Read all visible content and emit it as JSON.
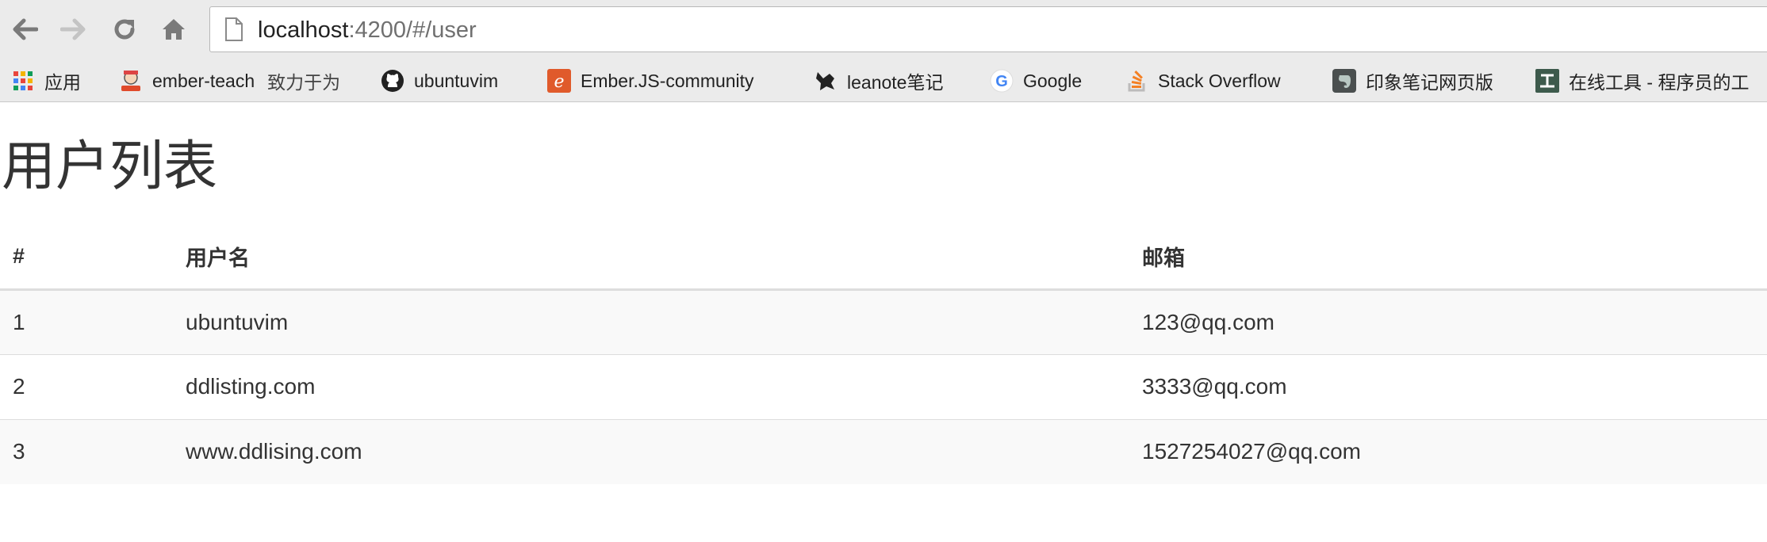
{
  "browser": {
    "url_host": "localhost",
    "url_rest": ":4200/#/user",
    "bookmarks": [
      {
        "label": "应用",
        "icon": "apps-grid-icon"
      },
      {
        "label": "ember-teach",
        "note": "致力于为",
        "icon": "ember-teach-icon"
      },
      {
        "label": "ubuntuvim",
        "icon": "github-icon"
      },
      {
        "label": "Ember.JS-community",
        "icon": "ember-community-icon"
      },
      {
        "label": "leanote笔记",
        "icon": "leanote-icon"
      },
      {
        "label": "Google",
        "icon": "google-icon"
      },
      {
        "label": "Stack Overflow",
        "icon": "stackoverflow-icon"
      },
      {
        "label": "印象笔记网页版",
        "icon": "evernote-icon"
      },
      {
        "label": "在线工具 - 程序员的工",
        "icon": "online-tools-icon"
      }
    ]
  },
  "page": {
    "title": "用户列表",
    "table": {
      "headers": [
        "#",
        "用户名",
        "邮箱"
      ],
      "rows": [
        {
          "id": "1",
          "name": "ubuntuvim",
          "email": "123@qq.com"
        },
        {
          "id": "2",
          "name": "ddlisting.com",
          "email": "3333@qq.com"
        },
        {
          "id": "3",
          "name": "www.ddlising.com",
          "email": "1527254027@qq.com"
        }
      ]
    }
  },
  "colors": {
    "chrome_bg": "#ebebeb",
    "table_stripe": "#f9f9f9",
    "border": "#dddddd",
    "text": "#333333"
  }
}
